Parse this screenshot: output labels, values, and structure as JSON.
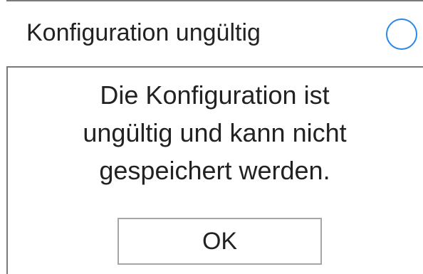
{
  "dialog": {
    "title": "Konfiguration ungültig",
    "message_lines": [
      "Die Konfiguration ist",
      "ungültig und kann nicht",
      "gespeichert werden."
    ],
    "ok_label": "OK",
    "close_icon": "circle-icon"
  },
  "colors": {
    "accent": "#2a86e8",
    "border": "#7a7a7a",
    "button_border": "#a6a6a6",
    "text": "#222222",
    "background": "#ffffff"
  }
}
